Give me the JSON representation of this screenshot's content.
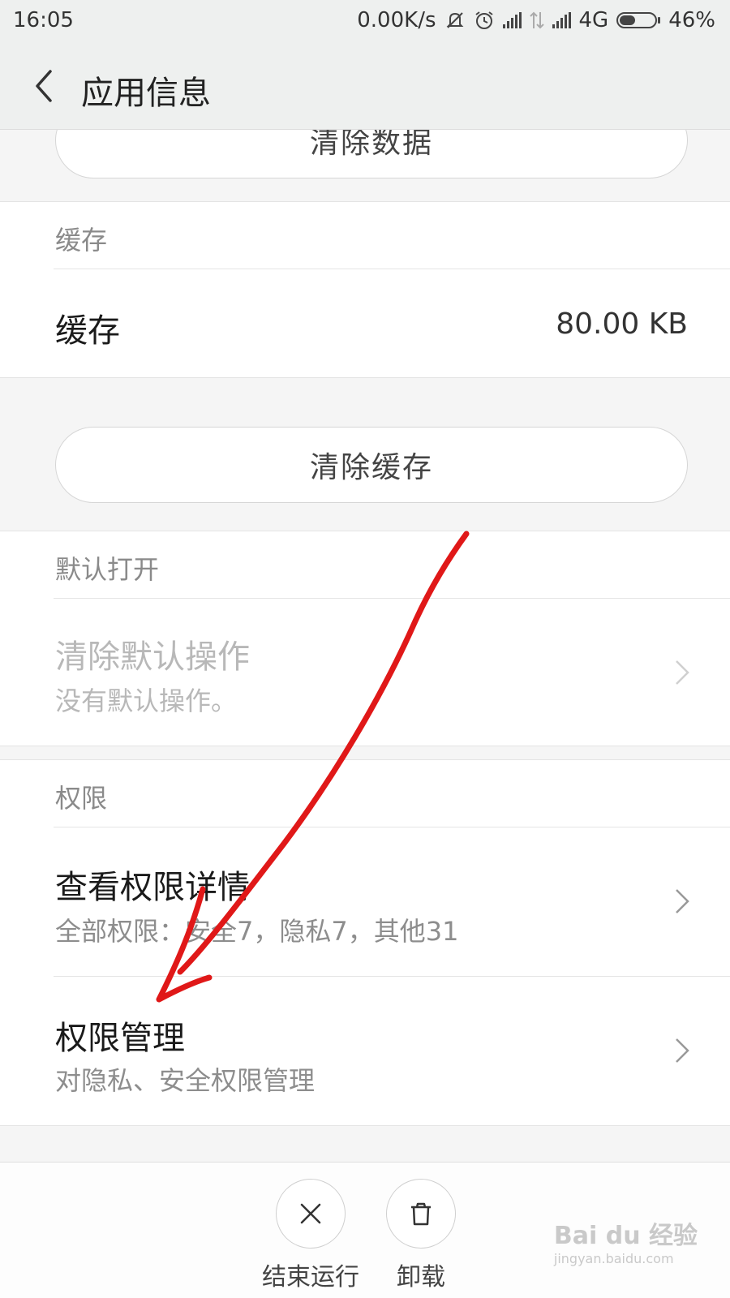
{
  "status_bar": {
    "time": "16:05",
    "network_speed": "0.00K/s",
    "network_type": "4G",
    "battery": "46%",
    "battery_level": 0.46,
    "icons": [
      "mute-icon",
      "alarm-icon",
      "signal-icon",
      "data-transfer-icon",
      "signal-icon",
      "battery-icon"
    ]
  },
  "header": {
    "title": "应用信息",
    "back_icon": "chevron-left-icon"
  },
  "buttons": {
    "clear_data": "清除数据",
    "clear_cache": "清除缓存"
  },
  "cache_section": {
    "header": "缓存",
    "row_label": "缓存",
    "row_value": "80.00 KB"
  },
  "default_open_section": {
    "header": "默认打开",
    "row_title": "清除默认操作",
    "row_sub": "没有默认操作。"
  },
  "permissions_section": {
    "header": "权限",
    "view_details_title": "查看权限详情",
    "view_details_sub": "全部权限：安全7，隐私7，其他31",
    "manage_title": "权限管理",
    "manage_sub": "对隐私、安全权限管理"
  },
  "bottom_actions": {
    "force_stop": "结束运行",
    "uninstall": "卸载"
  },
  "annotation": {
    "color": "#e01818",
    "icon": "red-arrow-annotation"
  },
  "watermark": {
    "brand": "Bai du 经验",
    "url": "jingyan.baidu.com"
  }
}
